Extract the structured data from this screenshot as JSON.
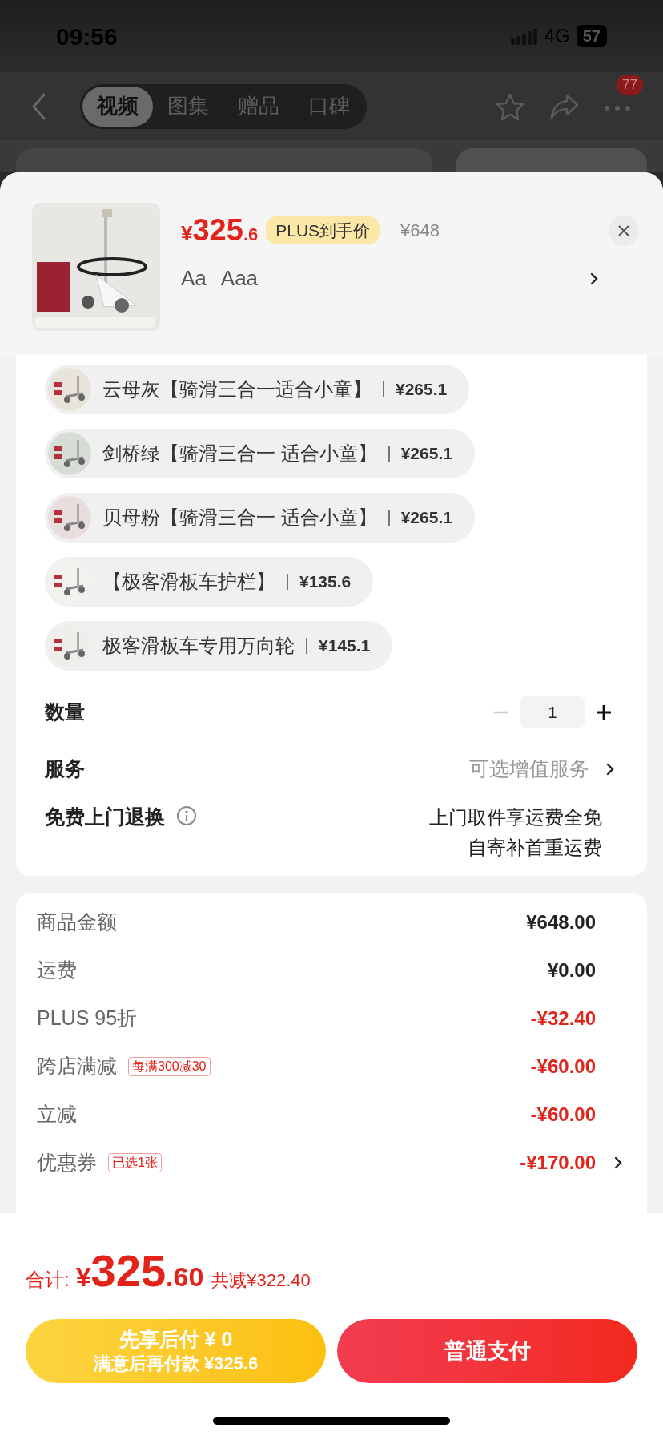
{
  "status_bar": {
    "time": "09:56",
    "network": "4G",
    "battery": "57"
  },
  "nav": {
    "tabs": [
      {
        "label": "视频",
        "selected": true
      },
      {
        "label": "图集",
        "selected": false
      },
      {
        "label": "赠品",
        "selected": false
      },
      {
        "label": "口碑",
        "selected": false
      }
    ],
    "badge": "77"
  },
  "product": {
    "currency": "¥",
    "price_int": "325",
    "price_dec": ".6",
    "plus_tag": "PLUS到手价",
    "original_price": "¥648",
    "specs": [
      "Aa",
      "Aaa"
    ]
  },
  "options": [
    {
      "label": "云母灰【骑滑三合一适合小童】",
      "price": "¥265.1"
    },
    {
      "label": "剑桥绿【骑滑三合一 适合小童】",
      "price": "¥265.1"
    },
    {
      "label": "贝母粉【骑滑三合一 适合小童】",
      "price": "¥265.1"
    },
    {
      "label": "【极客滑板车护栏】",
      "price": "¥135.6"
    },
    {
      "label": "极客滑板车专用万向轮",
      "price": "¥145.1"
    }
  ],
  "quantity": {
    "label": "数量",
    "value": "1",
    "minus_disabled": true
  },
  "service": {
    "label": "服务",
    "value": "可选增值服务"
  },
  "free_return": {
    "label": "免费上门退换",
    "lines": [
      "上门取件享运费全免",
      "自寄补首重运费"
    ]
  },
  "summary": [
    {
      "label": "商品金额",
      "amount": "¥648.00",
      "discount": false,
      "chevron": false
    },
    {
      "label": "运费",
      "amount": "¥0.00",
      "discount": false,
      "chevron": false
    },
    {
      "label": "PLUS 95折",
      "amount": "-¥32.40",
      "discount": true,
      "chevron": false
    },
    {
      "label": "跨店满减",
      "tag": "每满300减30",
      "amount": "-¥60.00",
      "discount": true,
      "chevron": false
    },
    {
      "label": "立减",
      "amount": "-¥60.00",
      "discount": true,
      "chevron": false
    },
    {
      "label": "优惠券",
      "tag": "已选1张",
      "amount": "-¥170.00",
      "discount": true,
      "chevron": true
    }
  ],
  "total": {
    "label": "合计:",
    "currency": "¥",
    "int": "325",
    "dec": ".60",
    "saved": "共减¥322.40"
  },
  "buttons": {
    "later_title": "先享后付 ¥ 0",
    "later_sub": "满意后再付款 ¥325.6",
    "pay": "普通支付"
  }
}
